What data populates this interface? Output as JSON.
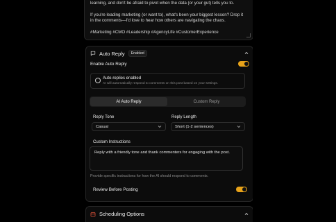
{
  "post": {
    "paragraph1": "learning, and don't be afraid to pivot when the data (or your gut) tells you to.",
    "paragraph2": "If you're leading marketing (or want to), what's been your biggest lesson? Drop it in the comments—I'd love to hear how others are navigating the chaos.",
    "hashtags": "#Marketing #CMO #Leadership #AgencyLife #CustomerExperience"
  },
  "auto_reply": {
    "title": "Auto Reply",
    "badge": "Enabled",
    "enable_label": "Enable Auto Reply",
    "enabled": true,
    "info_title": "Auto-replies enabled",
    "info_sub": "AI will automatically respond to comments on this post based on your settings.",
    "tabs": [
      {
        "label": "AI Auto Reply",
        "active": true
      },
      {
        "label": "Custom Reply",
        "active": false
      }
    ],
    "reply_tone_label": "Reply Tone",
    "reply_tone_value": "Casual",
    "reply_length_label": "Reply Length",
    "reply_length_value": "Short (1-2 sentences)",
    "custom_instructions_label": "Custom Instructions",
    "custom_instructions_value": "Reply with a friendly tone and thank commenters for engaging with the post.",
    "hint": "Provide specific instructions for how the AI should respond to comments.",
    "review_label": "Review Before Posting",
    "review_enabled": true
  },
  "scheduling": {
    "title": "Scheduling Options"
  },
  "colors": {
    "accent": "#e8a31a",
    "calendar_icon": "#e0533a",
    "background": "#000000"
  },
  "icons": {
    "auto_reply": "message-square-icon",
    "collapse": "chevron-up-icon",
    "dropdown": "chevron-down-icon",
    "scheduling": "calendar-icon"
  }
}
